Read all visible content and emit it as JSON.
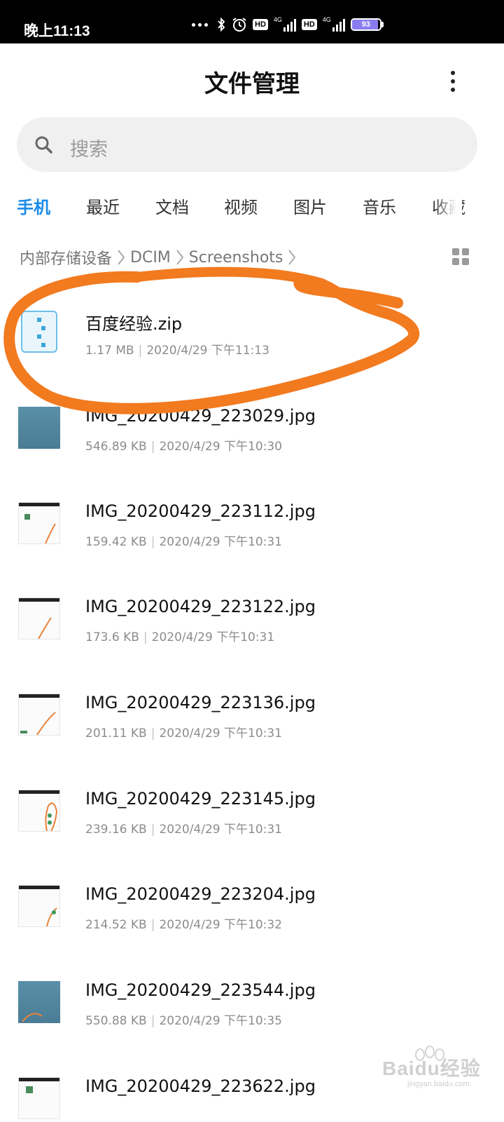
{
  "status_bar": {
    "time": "晚上11:13",
    "hd_1": "HD",
    "net_1": "4G",
    "hd_2": "HD",
    "net_2": "4G",
    "battery_level": "93",
    "battery_fraction": 0.93
  },
  "header": {
    "title": "文件管理"
  },
  "search": {
    "placeholder": "搜索"
  },
  "tabs": [
    {
      "label": "手机",
      "active": true
    },
    {
      "label": "最近"
    },
    {
      "label": "文档"
    },
    {
      "label": "视频"
    },
    {
      "label": "图片"
    },
    {
      "label": "音乐"
    },
    {
      "label": "收藏"
    }
  ],
  "breadcrumb": [
    "内部存储设备",
    "DCIM",
    "Screenshots"
  ],
  "files": [
    {
      "name": "百度经验.zip",
      "size": "1.17 MB",
      "date": "2020/4/29 下午11:13",
      "type": "zip"
    },
    {
      "name": "IMG_20200429_223029.jpg",
      "size": "546.89 KB",
      "date": "2020/4/29 下午10:30",
      "type": "image-dark"
    },
    {
      "name": "IMG_20200429_223112.jpg",
      "size": "159.42 KB",
      "date": "2020/4/29 下午10:31",
      "type": "image-light"
    },
    {
      "name": "IMG_20200429_223122.jpg",
      "size": "173.6 KB",
      "date": "2020/4/29 下午10:31",
      "type": "image-light"
    },
    {
      "name": "IMG_20200429_223136.jpg",
      "size": "201.11 KB",
      "date": "2020/4/29 下午10:31",
      "type": "image-light"
    },
    {
      "name": "IMG_20200429_223145.jpg",
      "size": "239.16 KB",
      "date": "2020/4/29 下午10:31",
      "type": "image-light"
    },
    {
      "name": "IMG_20200429_223204.jpg",
      "size": "214.52 KB",
      "date": "2020/4/29 下午10:32",
      "type": "image-light"
    },
    {
      "name": "IMG_20200429_223544.jpg",
      "size": "550.88 KB",
      "date": "2020/4/29 下午10:35",
      "type": "image-dark"
    },
    {
      "name": "IMG_20200429_223622.jpg",
      "type": "image-light"
    }
  ],
  "watermark": {
    "brand": "Baidu经验",
    "domain": "jingyan.baidu.com"
  },
  "colors": {
    "accent": "#1a8be8",
    "annotation": "#f27a1f",
    "status_bar": "#000000"
  }
}
